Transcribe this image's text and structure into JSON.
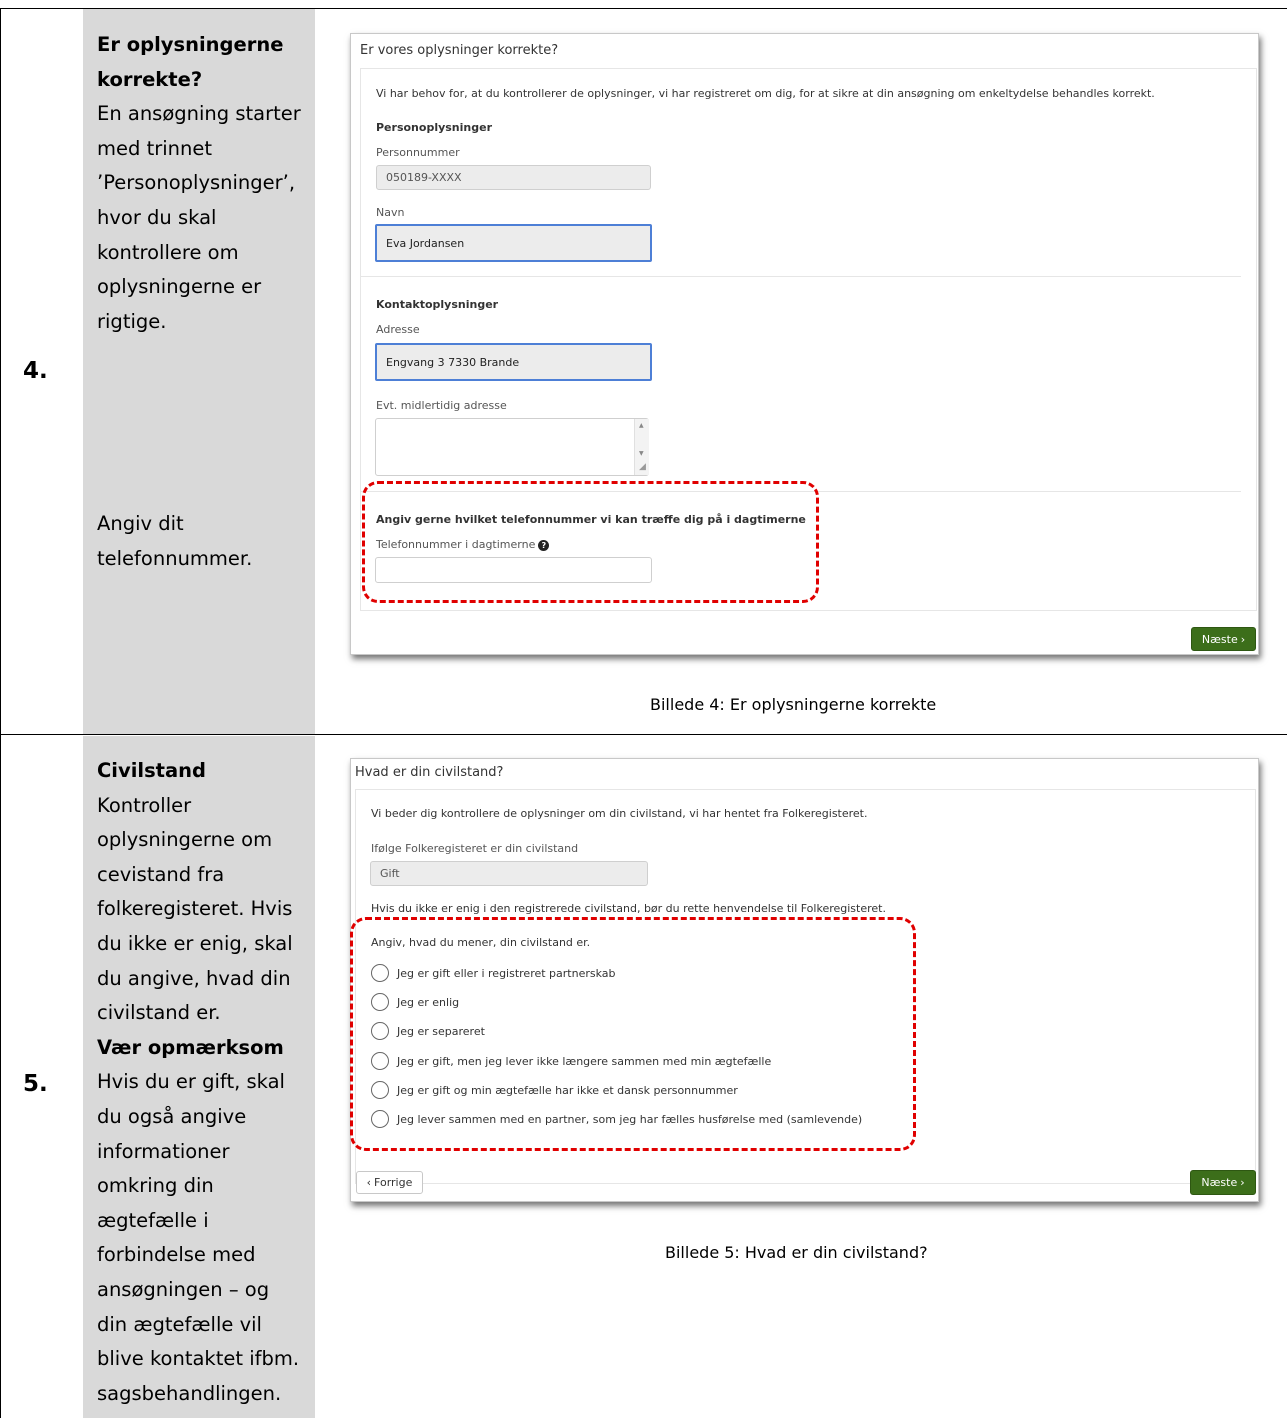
{
  "section4": {
    "number": "4.",
    "side_heading_1": "Er oplysningerne",
    "side_heading_2": "korrekte?",
    "side_lines": [
      "En ansøgning starter",
      "med trinnet",
      "’Personoplysninger’,",
      "hvor du skal",
      "kontrollere om",
      "oplysningerne er",
      "rigtige."
    ],
    "side_phone_lines": [
      "Angiv dit",
      "telefonnummer."
    ],
    "form": {
      "title": "Er vores oplysninger korrekte?",
      "intro": "Vi har behov for, at du kontrollerer de oplysninger, vi har registreret om dig, for at sikre at din ansøgning om enkeltydelse behandles korrekt.",
      "personal_heading": "Personoplysninger",
      "cpr_label": "Personnummer",
      "cpr_value": "050189-XXXX",
      "name_label": "Navn",
      "name_value": "Eva Jordansen",
      "contact_heading": "Kontaktoplysninger",
      "address_label": "Adresse",
      "address_value": "Engvang 3 7330 Brande",
      "temp_address_label": "Evt. midlertidig adresse",
      "phone_heading": "Angiv gerne hvilket telefonnummer vi kan træffe dig på i dagtimerne",
      "phone_label": "Telefonnummer i dagtimerne",
      "next_label": "Næste"
    },
    "caption": "Billede 4: Er oplysningerne korrekte"
  },
  "section5": {
    "number": "5.",
    "side_heading": "Civilstand",
    "side_lines_1": [
      "Kontroller",
      "oplysningerne om",
      "cevistand fra",
      "folkeregisteret. Hvis",
      "du ikke er enig, skal",
      "du angive, hvad din",
      "civilstand er."
    ],
    "side_heading_2": "Vær opmærksom",
    "side_lines_2": [
      "Hvis du er gift, skal",
      "du også angive",
      "informationer",
      "omkring din",
      "ægtefælle i",
      "forbindelse med",
      "ansøgningen – og",
      "din ægtefælle vil",
      "blive kontaktet ifbm.",
      "sagsbehandlingen."
    ],
    "form": {
      "title": "Hvad er din civilstand?",
      "intro": "Vi beder dig kontrollere de oplysninger om din civilstand, vi har hentet fra Folkeregisteret.",
      "status_label": "Ifølge Folkeregisteret er din civilstand",
      "status_value": "Gift",
      "disagree_note": "Hvis du ikke er enig i den registrerede civilstand, bør du rette henvendelse til Folkeregisteret.",
      "choose_label": "Angiv, hvad du mener, din civilstand er.",
      "options": [
        "Jeg er gift eller i registreret partnerskab",
        "Jeg er enlig",
        "Jeg er separeret",
        "Jeg er gift, men jeg lever ikke længere sammen med min ægtefælle",
        "Jeg er gift og min ægtefælle har ikke et dansk personnummer",
        "Jeg lever sammen med en partner, som jeg har fælles husførelse med (samlevende)"
      ],
      "prev_label": "Forrige",
      "next_label": "Næste"
    },
    "caption": "Billede 5: Hvad er din civilstand?"
  }
}
